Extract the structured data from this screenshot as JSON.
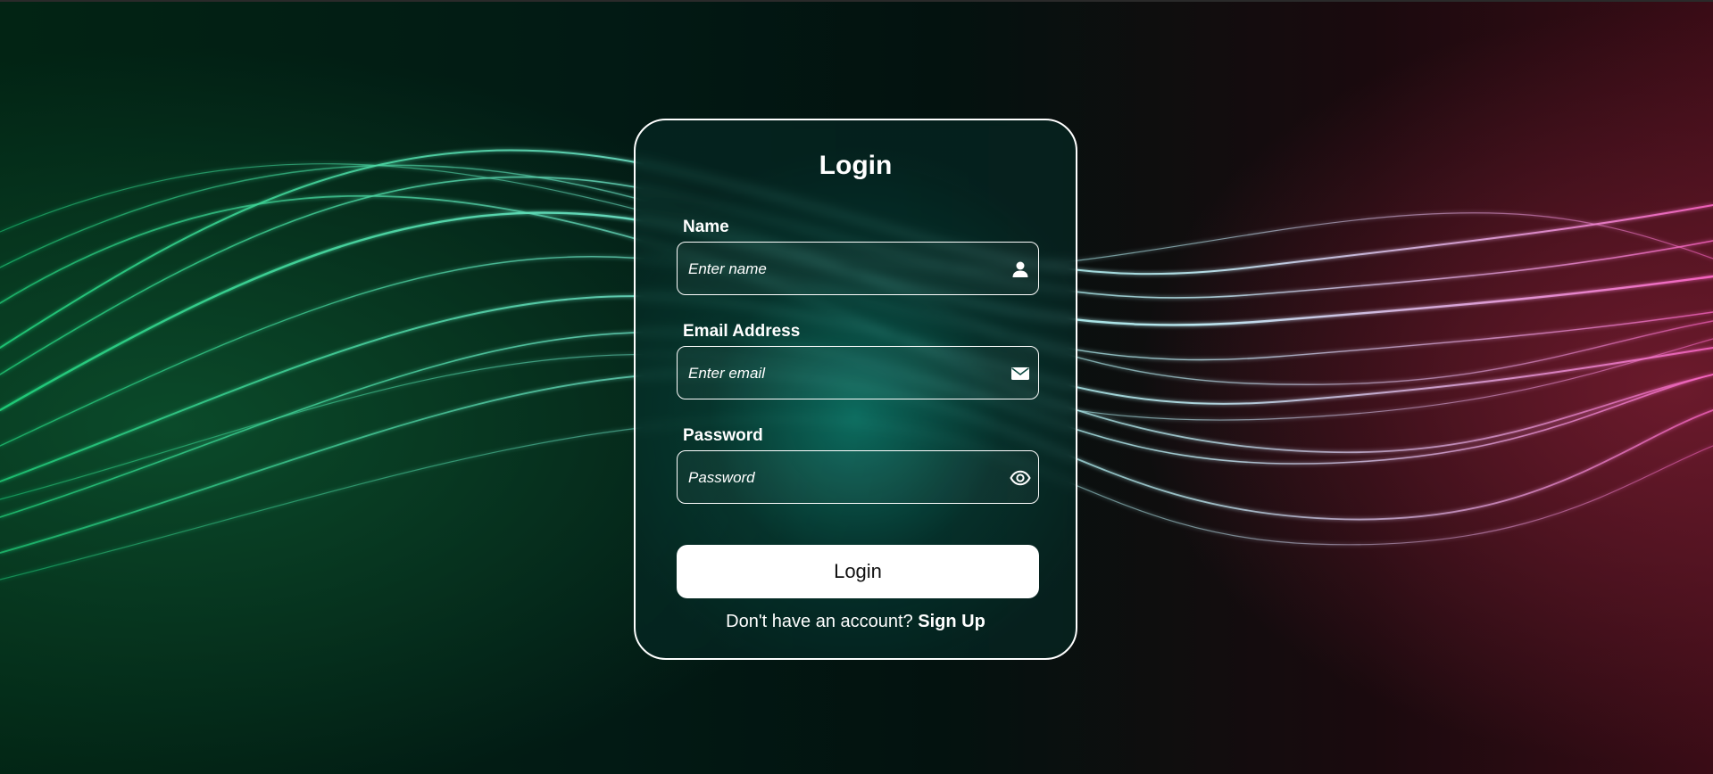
{
  "form": {
    "title": "Login",
    "name": {
      "label": "Name",
      "placeholder": "Enter name",
      "value": "",
      "icon": "user-icon"
    },
    "email": {
      "label": "Email Address",
      "placeholder": "Enter email",
      "value": "",
      "icon": "envelope-icon"
    },
    "password": {
      "label": "Password",
      "placeholder": "Password",
      "value": "",
      "icon": "eye-icon"
    },
    "submit_label": "Login",
    "signup_prompt": "Don't have an account?",
    "signup_link": "Sign Up"
  },
  "colors": {
    "accent": "#ffffff",
    "wave_green": "#2de08a",
    "wave_cyan": "#8ef4ff",
    "wave_pink": "#ff6fd0"
  }
}
